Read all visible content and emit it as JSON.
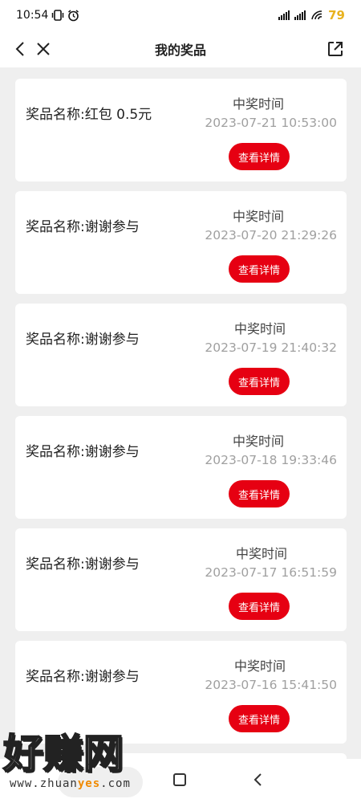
{
  "status_bar": {
    "time": "10:54",
    "battery": "79",
    "icons": [
      "vibrate-icon",
      "alarm-icon",
      "signal-icon",
      "signal-icon",
      "wifi-icon"
    ]
  },
  "nav": {
    "title": "我的奖品",
    "icons": [
      "back-arrow-icon",
      "close-icon",
      "share-icon"
    ]
  },
  "prizes": [
    {
      "name": "奖品名称:红包 0.5元",
      "time_label": "中奖时间",
      "time": "2023-07-21 10:53:00",
      "button": "查看详情"
    },
    {
      "name": "奖品名称:谢谢参与",
      "time_label": "中奖时间",
      "time": "2023-07-20 21:29:26",
      "button": "查看详情"
    },
    {
      "name": "奖品名称:谢谢参与",
      "time_label": "中奖时间",
      "time": "2023-07-19 21:40:32",
      "button": "查看详情"
    },
    {
      "name": "奖品名称:谢谢参与",
      "time_label": "中奖时间",
      "time": "2023-07-18 19:33:46",
      "button": "查看详情"
    },
    {
      "name": "奖品名称:谢谢参与",
      "time_label": "中奖时间",
      "time": "2023-07-17 16:51:59",
      "button": "查看详情"
    },
    {
      "name": "奖品名称:谢谢参与",
      "time_label": "中奖时间",
      "time": "2023-07-16 15:41:50",
      "button": "查看详情"
    }
  ],
  "colors": {
    "accent": "#e60012",
    "background": "#efefef",
    "muted_text": "#a0a0a0",
    "battery": "#e8b21e"
  },
  "watermark": {
    "text": "好赚网",
    "url_prefix": "www.zhuan",
    "url_highlight": "yes",
    "url_suffix": ".com"
  },
  "system_nav": {
    "icons": [
      "home-pill",
      "recents-square-icon",
      "back-triangle-icon"
    ]
  }
}
